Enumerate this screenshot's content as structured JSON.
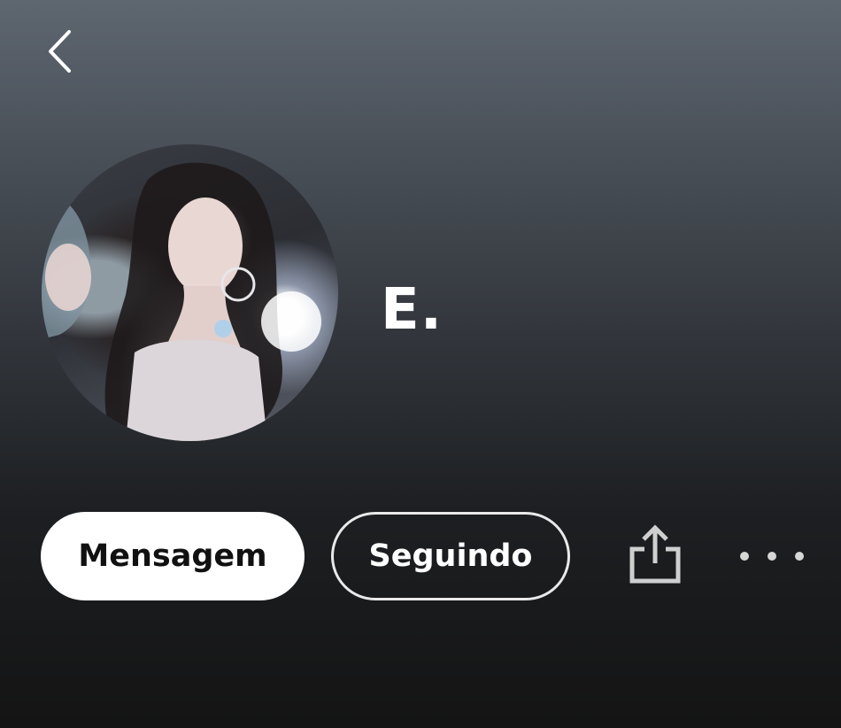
{
  "header": {
    "back_icon": "chevron-left-icon"
  },
  "profile": {
    "name": "E.",
    "avatar_description_icon": "profile-photo"
  },
  "actions": {
    "message_label": "Mensagem",
    "following_label": "Seguindo",
    "share_icon": "share-icon",
    "more_icon": "more-dots-icon"
  },
  "colors": {
    "background_top": "#5e6670",
    "background_bottom": "#141414",
    "primary_button_bg": "#ffffff",
    "primary_button_text": "#111111",
    "outline_border": "#e9e9e9",
    "icon_gray": "#cfcfcf"
  }
}
